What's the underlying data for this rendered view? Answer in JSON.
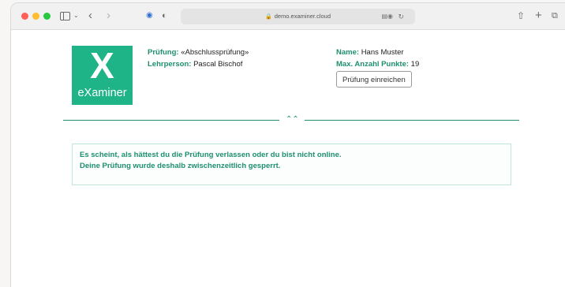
{
  "browser": {
    "url": "demo.examiner.cloud"
  },
  "logo": {
    "mark": "X",
    "wordmark": "eXaminer"
  },
  "exam": {
    "pruefung_label": "Prüfung:",
    "pruefung_value": "«Abschlussprüfung»",
    "lehrperson_label": "Lehrperson:",
    "lehrperson_value": "Pascal Bischof",
    "name_label": "Name:",
    "name_value": "Hans Muster",
    "punkte_label": "Max. Anzahl Punkte:",
    "punkte_value": "19",
    "submit_label": "Prüfung einreichen"
  },
  "alert": {
    "line1": "Es scheint, als hättest du die Prüfung verlassen oder du bist nicht online.",
    "line2": "Deine Prüfung wurde deshalb zwischenzeitlich gesperrt."
  },
  "colors": {
    "brand": "#1fb487",
    "accent_text": "#1e8f6e"
  },
  "icons": {
    "sidebar": "sidebar-icon",
    "back": "chevron-left-icon",
    "forward": "chevron-right-icon",
    "share": "share-icon",
    "new_tab": "plus-icon",
    "tabs": "tabs-overview-icon",
    "collapse": "double-chevron-up-icon"
  }
}
